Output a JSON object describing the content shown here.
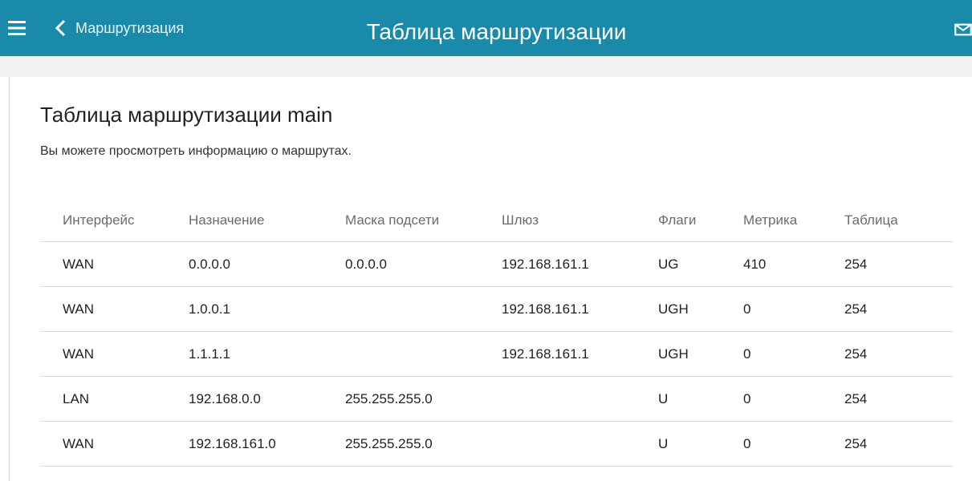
{
  "header": {
    "back_label": "Маршрутизация",
    "title": "Таблица маршрутизации",
    "icons": [
      "menu-icon",
      "chevron-left-icon",
      "mail-icon"
    ],
    "color": "#1a8aab"
  },
  "main": {
    "title": "Таблица маршрутизации main",
    "description": "Вы можете просмотреть информацию о маршрутах."
  },
  "table": {
    "columns": [
      "Интерфейс",
      "Назначение",
      "Маска подсети",
      "Шлюз",
      "Флаги",
      "Метрика",
      "Таблица"
    ],
    "rows": [
      [
        "WAN",
        "0.0.0.0",
        "0.0.0.0",
        "192.168.161.1",
        "UG",
        "410",
        "254"
      ],
      [
        "WAN",
        "1.0.0.1",
        "",
        "192.168.161.1",
        "UGH",
        "0",
        "254"
      ],
      [
        "WAN",
        "1.1.1.1",
        "",
        "192.168.161.1",
        "UGH",
        "0",
        "254"
      ],
      [
        "LAN",
        "192.168.0.0",
        "255.255.255.0",
        "",
        "U",
        "0",
        "254"
      ],
      [
        "WAN",
        "192.168.161.0",
        "255.255.255.0",
        "",
        "U",
        "0",
        "254"
      ]
    ]
  }
}
